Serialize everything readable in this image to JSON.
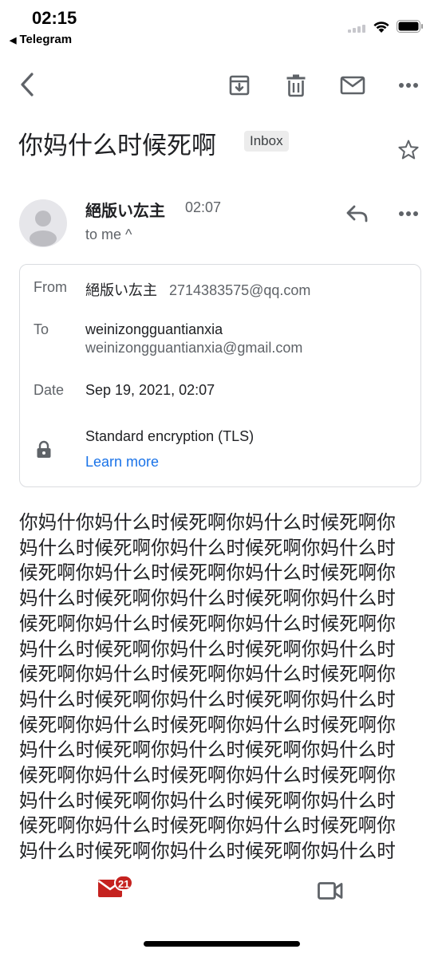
{
  "status_bar": {
    "time": "02:15",
    "back_app": "Telegram",
    "back_arrow": "◀"
  },
  "toolbar": {
    "icons": [
      "back-arrow-icon",
      "archive-icon",
      "delete-icon",
      "mark-unread-icon",
      "more-vert-icon"
    ]
  },
  "email": {
    "subject": "你妈什么时候死啊",
    "label": "Inbox",
    "sender_name": "絕版い厷主",
    "time": "02:07",
    "recipient_line": "to me ^",
    "details": {
      "from_label": "From",
      "from_name": "絕版い厷主",
      "from_email": "2714383575@qq.com",
      "to_label": "To",
      "to_name": "weinizongguantianxia",
      "to_email": "weinizongguantianxia@gmail.com",
      "date_label": "Date",
      "date_value": "Sep 19, 2021, 02:07",
      "encryption": "Standard encryption (TLS)",
      "learn_more": "Learn more"
    },
    "body": "你妈什你妈什么时候死啊你妈什么时候死啊你妈什么时候死啊你妈什么时候死啊你妈什么时候死啊你妈什么时候死啊你妈什么时候死啊你妈什么时候死啊你妈什么时候死啊你妈什么时候死啊你妈什么时候死啊你妈什么时候死啊你妈什么时候死啊你妈什么时候死啊你妈什么时候死啊你妈什么时候死啊你妈什么时候死啊你妈什么时候死啊你妈什么时候死啊你妈什么时候死啊你妈什么时候死啊你妈什么时候死啊你妈什么时候死啊你妈什么时候死啊你妈什么时候死啊你妈什么时候死啊你妈什么时候死啊你妈什么时候死啊你妈什么时候死啊你妈什么时候死啊你妈什么时候死啊你妈什么时候死啊你妈什么时候死啊你妈什么时候死啊你妈什么时候死"
  },
  "bottom_nav": {
    "mail_count": "21",
    "colors": {
      "mail_icon": "#c5221f",
      "meet_icon": "#5f6368"
    }
  },
  "colors": {
    "link": "#1a73e8",
    "text_primary": "#202124",
    "text_secondary": "#5f6368",
    "badge_bg": "#ececec"
  }
}
